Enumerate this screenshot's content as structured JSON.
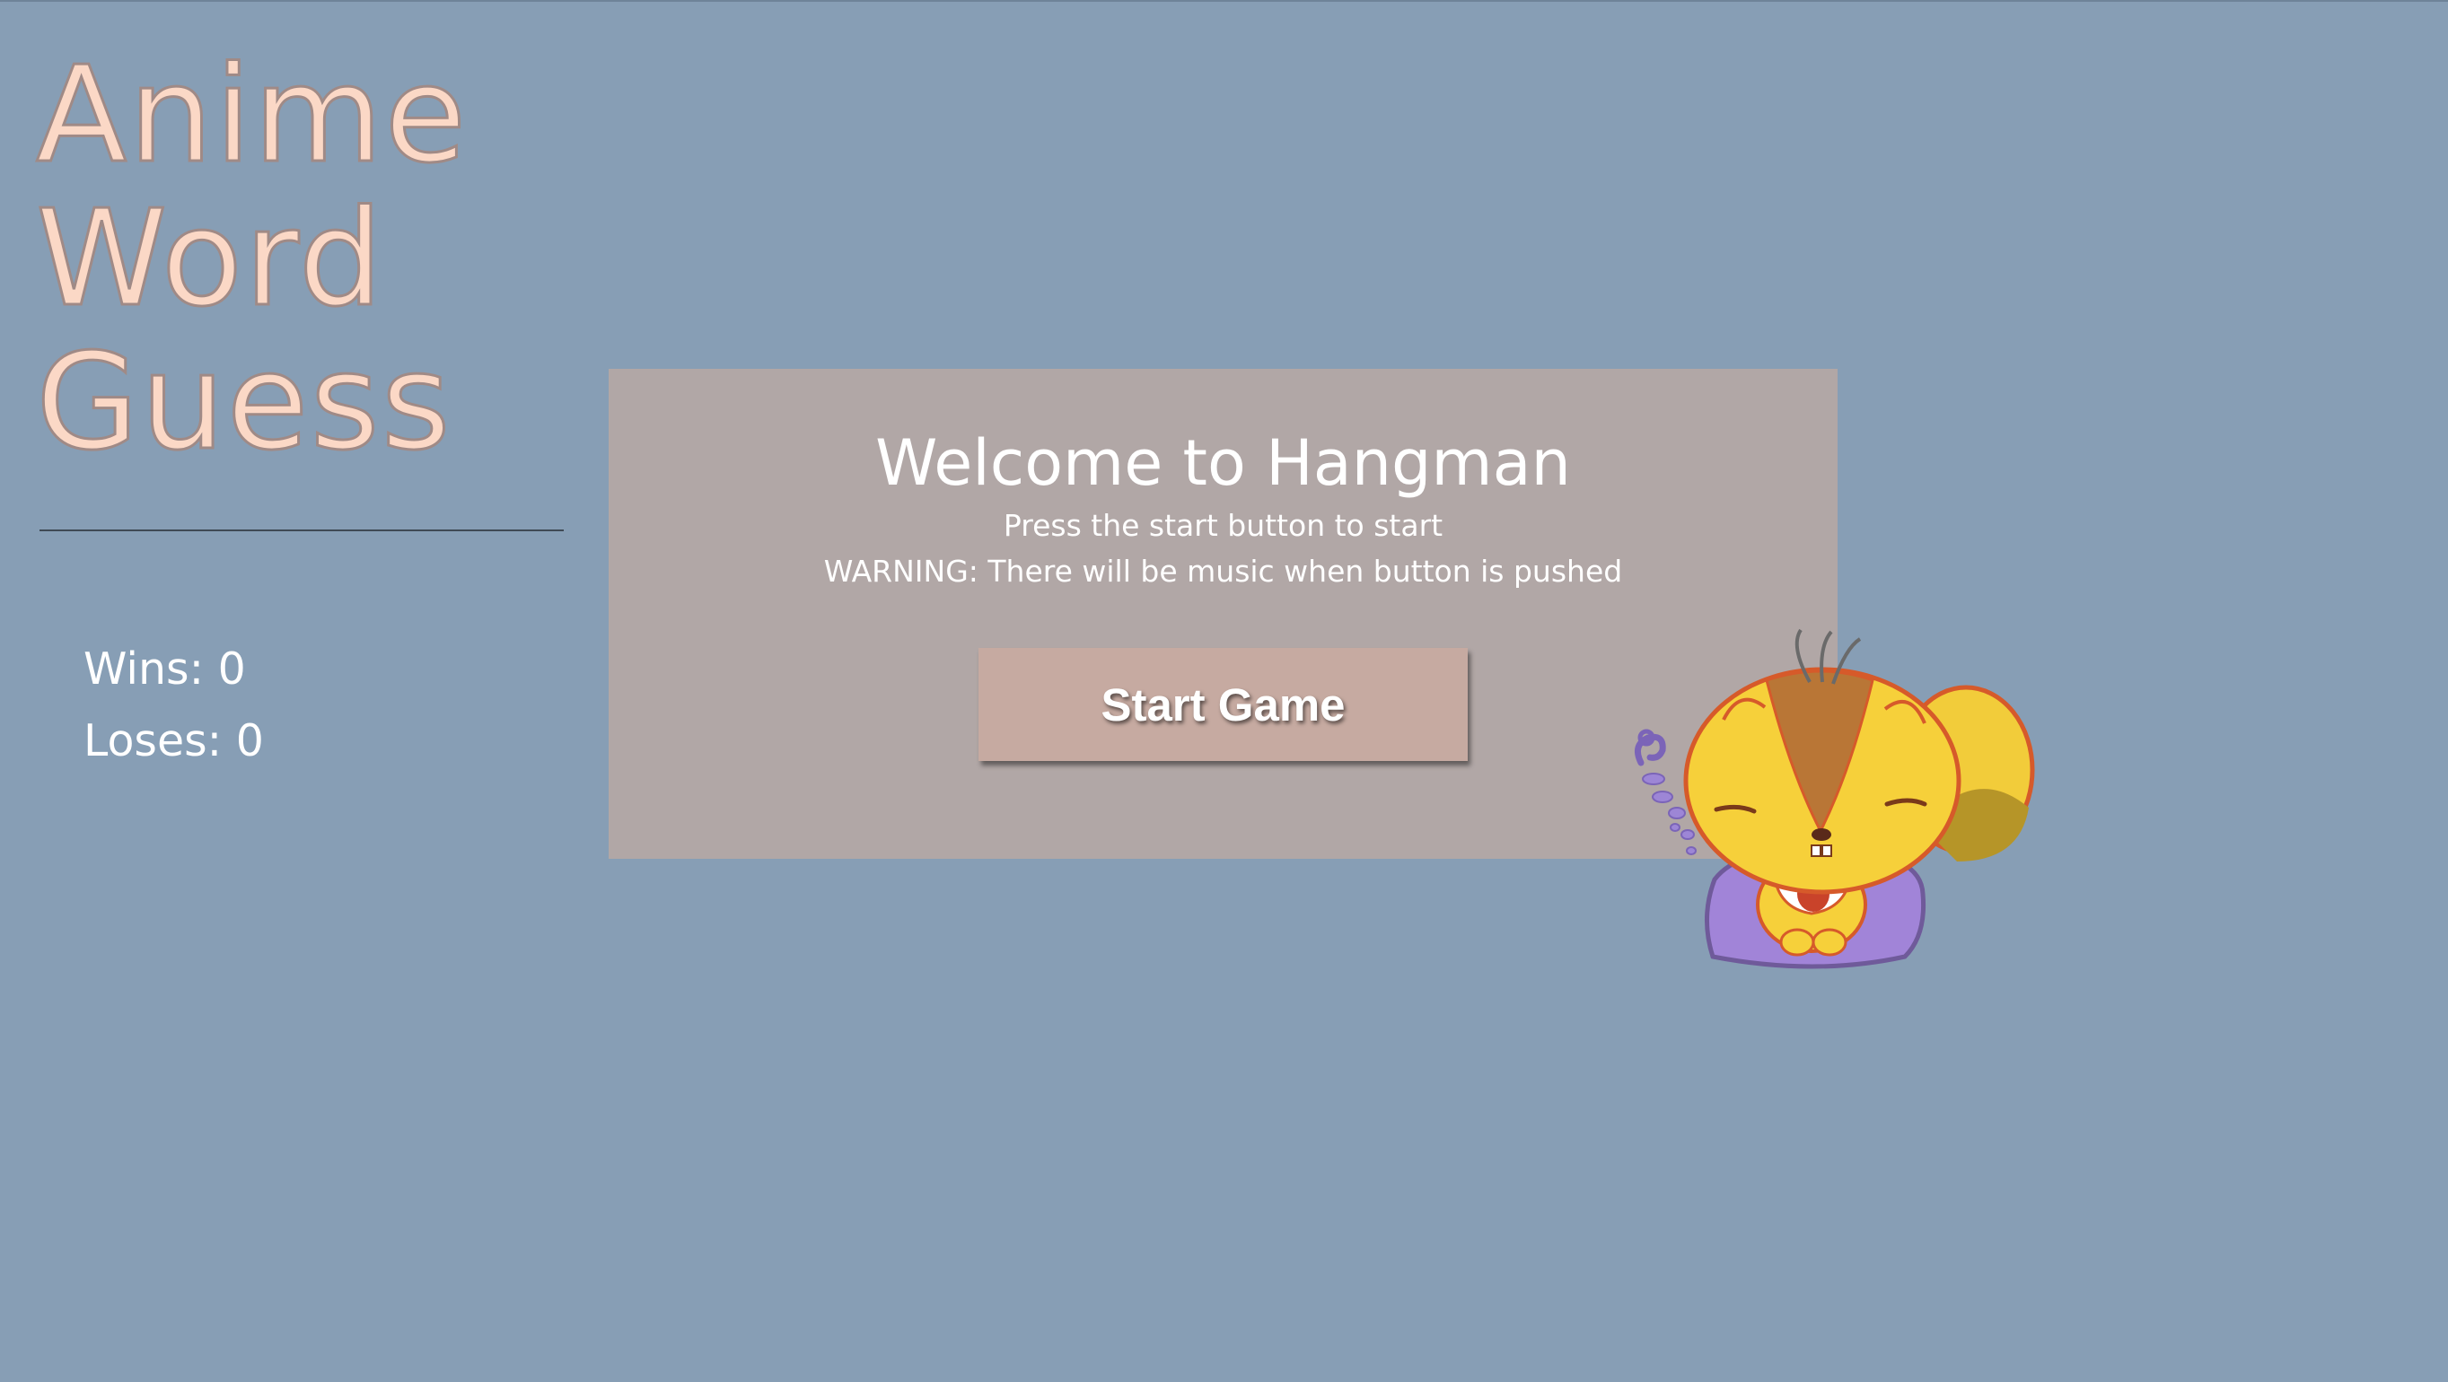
{
  "title": {
    "lines": [
      "Anime",
      "Word",
      "Guess"
    ]
  },
  "stats": {
    "wins_label": "Wins: ",
    "wins_value": "0",
    "loses_label": "Loses: ",
    "loses_value": "0"
  },
  "panel": {
    "heading": "Welcome to Hangman",
    "line1": "Press the start button to start",
    "line2": "WARNING: There will be music when button is pushed",
    "start_label": "Start Game"
  },
  "colors": {
    "background": "#879eb5",
    "title": "#fbd8c6",
    "panel": "#b1a7a6",
    "button": "#c6aaa1",
    "text": "#ffffff"
  },
  "mascot": {
    "icon": "squirrel-mascot-icon"
  }
}
